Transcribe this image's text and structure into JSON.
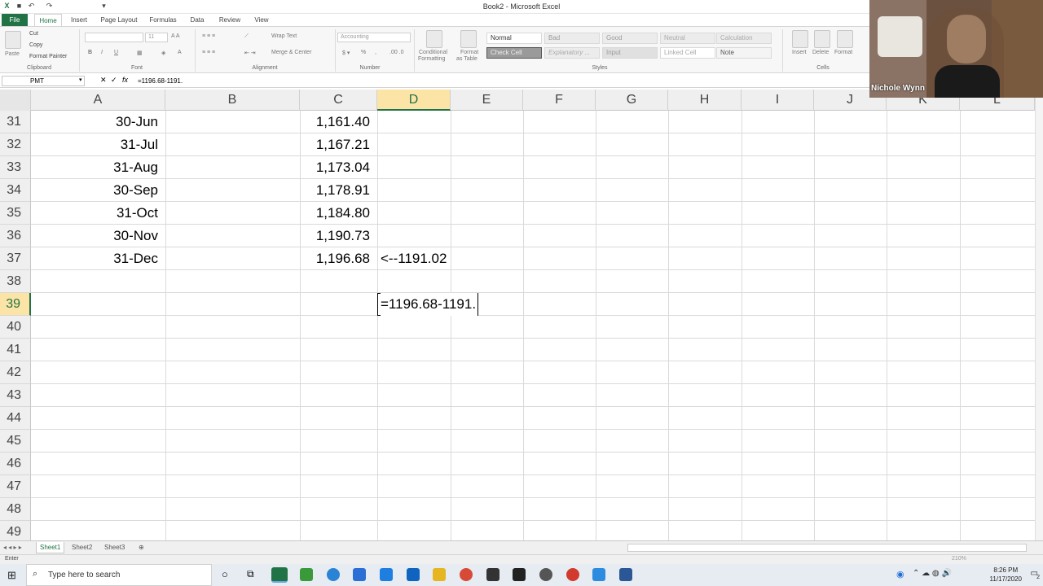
{
  "app": {
    "title": "Book2 - Microsoft Excel"
  },
  "ribbon_tabs": [
    "File",
    "Home",
    "Insert",
    "Page Layout",
    "Formulas",
    "Data",
    "Review",
    "View"
  ],
  "clipboard": {
    "paste": "Paste",
    "cut": "Cut",
    "copy": "Copy",
    "format_painter": "Format Painter",
    "label": "Clipboard"
  },
  "font": {
    "size": "11",
    "label": "Font"
  },
  "alignment": {
    "wrap_text": "Wrap Text",
    "merge_center": "Merge & Center",
    "label": "Alignment"
  },
  "number": {
    "format": "Accounting",
    "label": "Number"
  },
  "styles": {
    "conditional": [
      "Conditional",
      "Formatting"
    ],
    "format_table": [
      "Format",
      "as Table"
    ],
    "cells": [
      "Normal",
      "Bad",
      "Good",
      "Neutral",
      "Calculation",
      "Check Cell",
      "Explanatory ...",
      "Input",
      "Linked Cell",
      "Note"
    ],
    "label": "Styles"
  },
  "cells_group": {
    "insert": "Insert",
    "delete": "Delete",
    "format": "Format",
    "label": "Cells"
  },
  "formula_bar": {
    "name_box": "PMT",
    "fx": "fx",
    "formula": "=1196.68-1191."
  },
  "columns": [
    "A",
    "B",
    "C",
    "D",
    "E",
    "F",
    "G",
    "H",
    "I",
    "J",
    "K",
    "L"
  ],
  "rows": [
    {
      "num": "31",
      "a": "30-Jun",
      "c": "1,161.40",
      "d": ""
    },
    {
      "num": "32",
      "a": "31-Jul",
      "c": "1,167.21",
      "d": ""
    },
    {
      "num": "33",
      "a": "31-Aug",
      "c": "1,173.04",
      "d": ""
    },
    {
      "num": "34",
      "a": "30-Sep",
      "c": "1,178.91",
      "d": ""
    },
    {
      "num": "35",
      "a": "31-Oct",
      "c": "1,184.80",
      "d": ""
    },
    {
      "num": "36",
      "a": "30-Nov",
      "c": "1,190.73",
      "d": ""
    },
    {
      "num": "37",
      "a": "31-Dec",
      "c": "1,196.68",
      "d": "<--1191.02"
    },
    {
      "num": "38",
      "a": "",
      "c": "",
      "d": ""
    },
    {
      "num": "39",
      "a": "",
      "c": "",
      "d": ""
    },
    {
      "num": "40",
      "a": "",
      "c": "",
      "d": ""
    },
    {
      "num": "41",
      "a": "",
      "c": "",
      "d": ""
    },
    {
      "num": "42",
      "a": "",
      "c": "",
      "d": ""
    },
    {
      "num": "43",
      "a": "",
      "c": "",
      "d": ""
    },
    {
      "num": "44",
      "a": "",
      "c": "",
      "d": ""
    },
    {
      "num": "45",
      "a": "",
      "c": "",
      "d": ""
    },
    {
      "num": "46",
      "a": "",
      "c": "",
      "d": ""
    },
    {
      "num": "47",
      "a": "",
      "c": "",
      "d": ""
    },
    {
      "num": "48",
      "a": "",
      "c": "",
      "d": ""
    },
    {
      "num": "49",
      "a": "",
      "c": "",
      "d": ""
    }
  ],
  "editing_cell": {
    "text": "=1196.68-1191."
  },
  "sheet_tabs": [
    "Sheet1",
    "Sheet2",
    "Sheet3"
  ],
  "status": {
    "mode": "Enter",
    "zoom": "210%"
  },
  "taskbar": {
    "search_placeholder": "Type here to search",
    "time": "8:26 PM",
    "date": "11/17/2020",
    "notifications": "2"
  },
  "webcam": {
    "name": "Nichole Wynn"
  },
  "colors": {
    "excel_green": "#217346",
    "selected_header": "#fce4a6"
  }
}
